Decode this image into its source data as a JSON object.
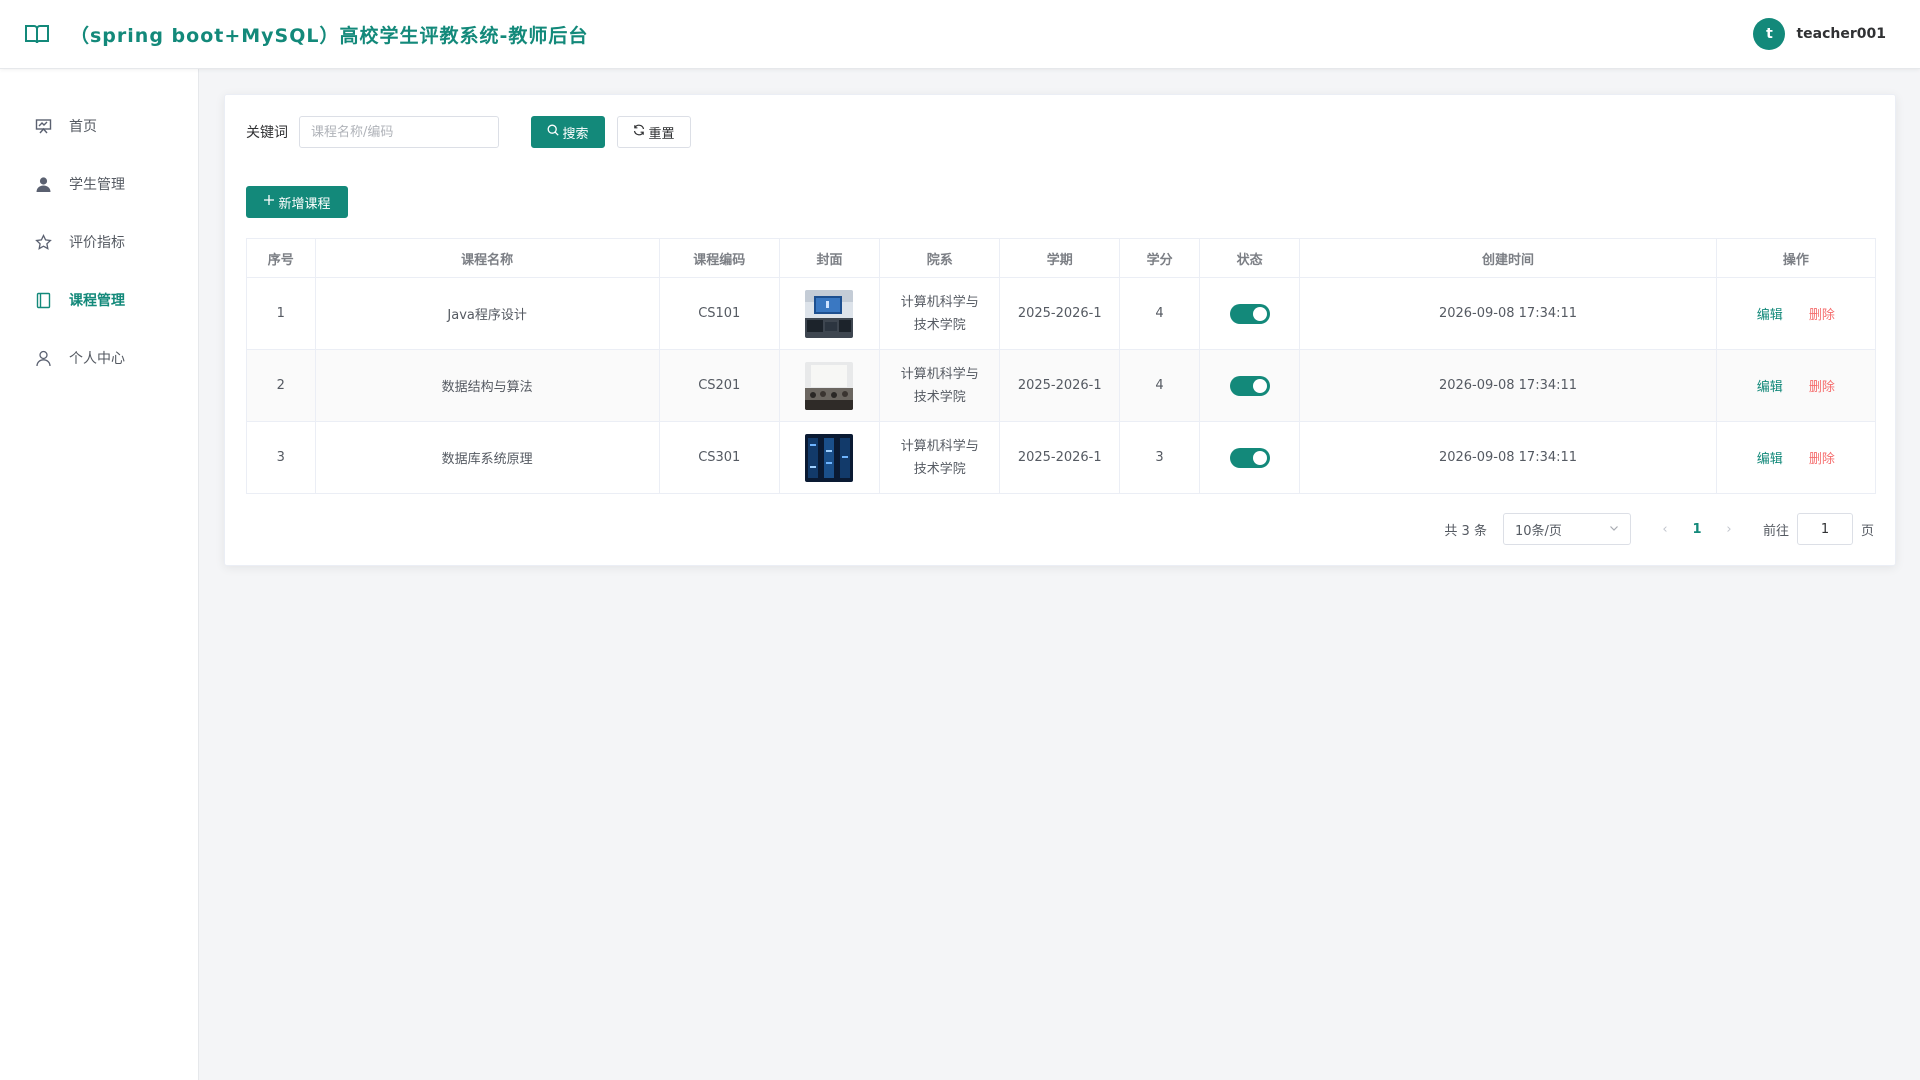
{
  "header": {
    "title": "（spring boot+MySQL）高校学生评教系统-教师后台",
    "avatar_letter": "t",
    "username": "teacher001",
    "accent_color": "#13897a"
  },
  "sidebar": {
    "items": [
      {
        "label": "首页",
        "icon": "presentation-board-icon",
        "active": false
      },
      {
        "label": "学生管理",
        "icon": "user-filled-icon",
        "active": false
      },
      {
        "label": "评价指标",
        "icon": "star-outline-icon",
        "active": false
      },
      {
        "label": "课程管理",
        "icon": "book-icon",
        "active": true
      },
      {
        "label": "个人中心",
        "icon": "user-outline-icon",
        "active": false
      }
    ]
  },
  "search": {
    "label": "关键词",
    "placeholder": "课程名称/编码",
    "value": "",
    "search_button": "搜索",
    "reset_button": "重置"
  },
  "toolbar": {
    "add_button": "新增课程"
  },
  "table": {
    "columns": [
      "序号",
      "课程名称",
      "课程编码",
      "封面",
      "院系",
      "学期",
      "学分",
      "状态",
      "创建时间",
      "操作"
    ],
    "rows": [
      {
        "index": "1",
        "name": "Java程序设计",
        "code": "CS101",
        "cover": "classroom-monitor-image",
        "dept_line1": "计算机科学与",
        "dept_line2": "技术学院",
        "term": "2025-2026-1",
        "credit": "4",
        "enabled": true,
        "created": "2026-09-08 17:34:11"
      },
      {
        "index": "2",
        "name": "数据结构与算法",
        "code": "CS201",
        "cover": "lecture-hall-image",
        "dept_line1": "计算机科学与",
        "dept_line2": "技术学院",
        "term": "2025-2026-1",
        "credit": "4",
        "enabled": true,
        "created": "2026-09-08 17:34:11"
      },
      {
        "index": "3",
        "name": "数据库系统原理",
        "code": "CS301",
        "cover": "server-room-image",
        "dept_line1": "计算机科学与",
        "dept_line2": "技术学院",
        "term": "2025-2026-1",
        "credit": "3",
        "enabled": true,
        "created": "2026-09-08 17:34:11"
      }
    ],
    "edit_label": "编辑",
    "delete_label": "删除"
  },
  "pagination": {
    "total": "共 3 条",
    "page_size": "10条/页",
    "current_page": "1",
    "goto_label": "前往",
    "goto_value": "1",
    "page_suffix": "页"
  }
}
